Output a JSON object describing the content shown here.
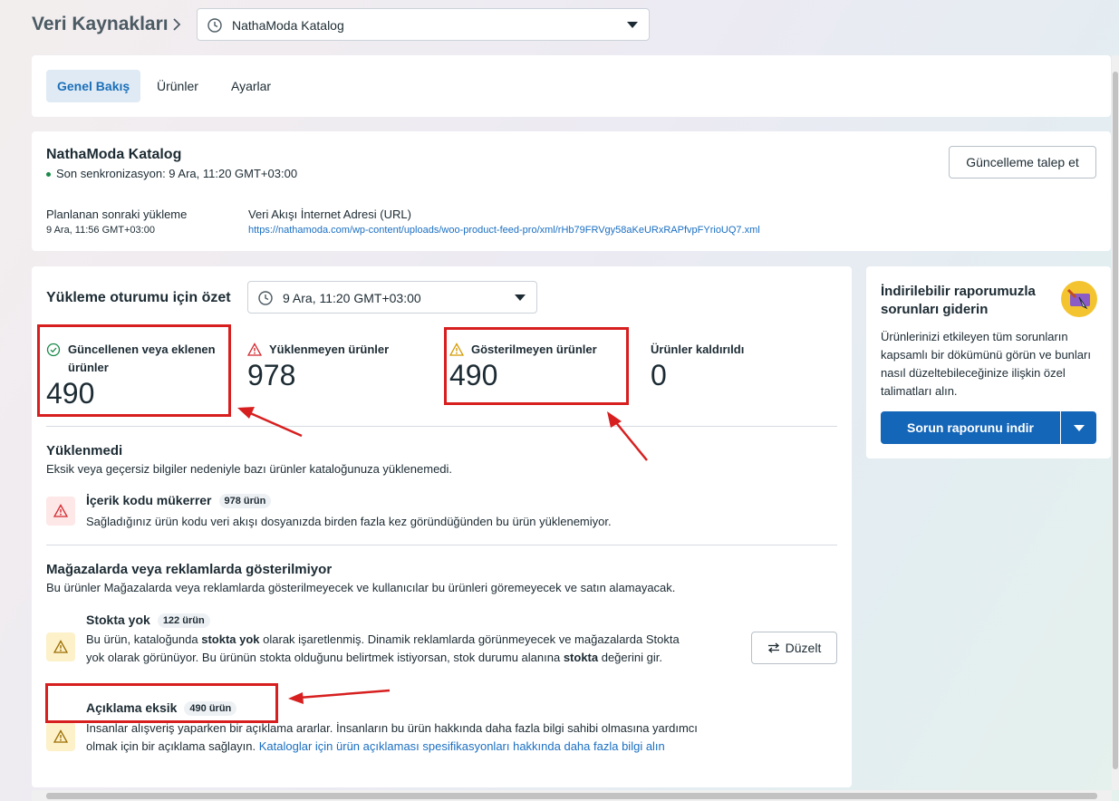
{
  "header": {
    "breadcrumb_title": "Veri Kaynakları",
    "catalog_select_value": "NathaModa Katalog"
  },
  "tabs": [
    {
      "label": "Genel Bakış",
      "active": true
    },
    {
      "label": "Ürünler",
      "active": false
    },
    {
      "label": "Ayarlar",
      "active": false
    }
  ],
  "catalog_info": {
    "name": "NathaModa Katalog",
    "last_sync": "Son senkronizasyon: 9 Ara, 11:20 GMT+03:00",
    "next_upload_label": "Planlanan sonraki yükleme",
    "next_upload_value": "9 Ara, 11:56 GMT+03:00",
    "feed_url_label": "Veri Akışı İnternet Adresi (URL)",
    "feed_url_value": "https://nathamoda.com/wp-content/uploads/woo-product-feed-pro/xml/rHb79FRVgy58aKeURxRAPfvpFYrioUQ7.xml",
    "request_update_label": "Güncelleme talep et"
  },
  "summary": {
    "title": "Yükleme oturumu için özet",
    "session_select_value": "9 Ara, 11:20 GMT+03:00",
    "stats": [
      {
        "label": "Güncellenen veya eklenen ürünler",
        "value": "490",
        "icon": "check-circle-icon"
      },
      {
        "label": "Yüklenmeyen ürünler",
        "value": "978",
        "icon": "error-triangle-icon"
      },
      {
        "label": "Gösterilmeyen ürünler",
        "value": "490",
        "icon": "warning-triangle-icon"
      },
      {
        "label": "Ürünler kaldırıldı",
        "value": "0",
        "icon": ""
      }
    ]
  },
  "not_uploaded": {
    "title": "Yüklenmedi",
    "description": "Eksik veya geçersiz bilgiler nedeniyle bazı ürünler kataloğunuza yüklenemedi.",
    "issue": {
      "title": "İçerik kodu mükerrer",
      "count": "978 ürün",
      "text": "Sağladığınız ürün kodu veri akışı dosyanızda birden fazla kez göründüğünden bu ürün yüklenemiyor."
    }
  },
  "not_shown": {
    "title": "Mağazalarda veya reklamlarda gösterilmiyor",
    "description": "Bu ürünler Mağazalarda veya reklamlarda gösterilmeyecek ve kullanıcılar bu ürünleri göremeyecek ve satın alamayacak.",
    "out_of_stock": {
      "title": "Stokta yok",
      "count": "122 ürün",
      "text_1": "Bu ürün, kataloğunda ",
      "text_bold_1": "stokta yok",
      "text_2": " olarak işaretlenmiş. Dinamik reklamlarda görünmeyecek ve mağazalarda Stokta yok olarak görünüyor. Bu ürünün stokta olduğunu belirtmek istiyorsan, stok durumu alanına ",
      "text_bold_2": "stokta",
      "text_3": " değerini gir.",
      "fix_label": "Düzelt"
    },
    "missing_description": {
      "title": "Açıklama eksik",
      "count": "490 ürün",
      "text": "İnsanlar alışveriş yaparken bir açıklama ararlar. İnsanların bu ürün hakkında daha fazla bilgi sahibi olmasına yardımcı olmak için bir açıklama sağlayın. ",
      "link": "Kataloglar için ürün açıklaması spesifikasyonları hakkında daha fazla bilgi alın"
    }
  },
  "report_card": {
    "title": "İndirilebilir raporumuzla sorunları giderin",
    "description": "Ürünlerinizi etkileyen tüm sorunların kapsamlı bir dökümünü görün ve bunları nasıl düzeltebileceğinize ilişkin özel talimatları alın.",
    "download_label": "Sorun raporunu indir"
  },
  "colors": {
    "accent": "#1466b8",
    "annotation_red": "#d71f1f",
    "success": "#1a8a4a",
    "error": "#d2282e",
    "warning": "#d49a00"
  }
}
